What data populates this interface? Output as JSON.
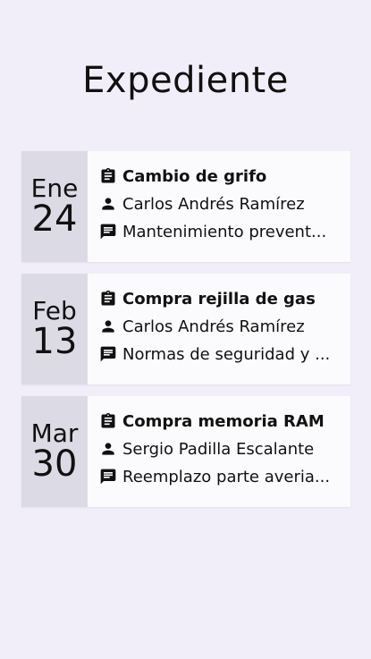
{
  "header": {
    "title": "Expediente"
  },
  "entries": [
    {
      "month": "Ene",
      "day": "24",
      "title": "Cambio de grifo",
      "person": "Carlos Andrés Ramírez",
      "note": "Mantenimiento prevent..."
    },
    {
      "month": "Feb",
      "day": "13",
      "title": "Compra rejilla de gas",
      "person": "Carlos Andrés Ramírez",
      "note": "Normas de seguridad y ..."
    },
    {
      "month": "Mar",
      "day": "30",
      "title": "Compra memoria RAM",
      "person": "Sergio Padilla Escalante",
      "note": "Reemplazo parte averia..."
    }
  ],
  "icons": {
    "title": "clipboard-icon",
    "person": "person-icon",
    "note": "comment-icon"
  }
}
